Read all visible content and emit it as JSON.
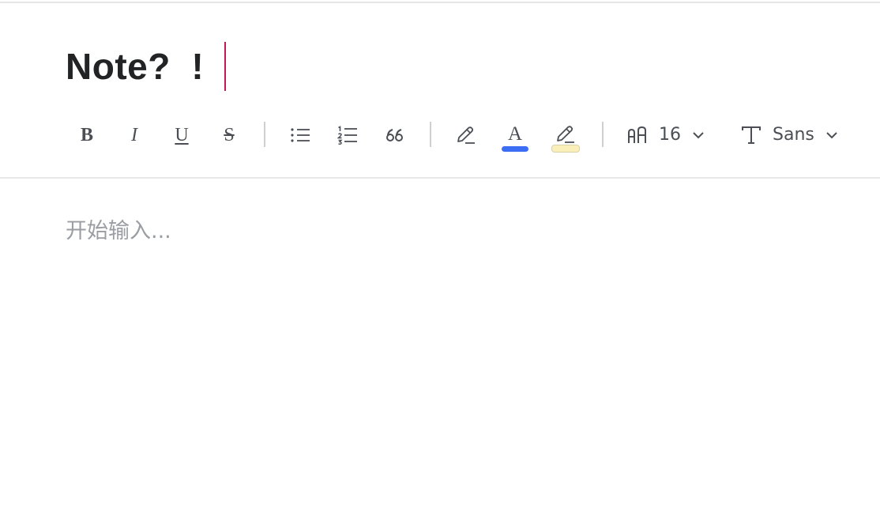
{
  "note": {
    "title": "Note?  !",
    "body_placeholder": "开始输入..."
  },
  "toolbar": {
    "bold_label": "B",
    "italic_label": "I",
    "underline_label": "U",
    "strike_label": "S",
    "font_color_label": "A",
    "font_size": {
      "value": "16",
      "icon": "font-size-icon"
    },
    "font_family": {
      "value": "Sans",
      "icon": "typeface-icon"
    },
    "icons": [
      "bullet-list-icon",
      "numbered-list-icon",
      "quote-icon",
      "pen-icon",
      "highlighter-icon",
      "chevron-down-icon"
    ]
  },
  "colors": {
    "caret": "#c2185b",
    "font_color": "#3b6ef5",
    "highlight_color": "#fbefb9",
    "highlight_border": "#d9d2a8",
    "text": "#222325",
    "icon": "#4b4f55",
    "placeholder": "#9a9ea3"
  }
}
